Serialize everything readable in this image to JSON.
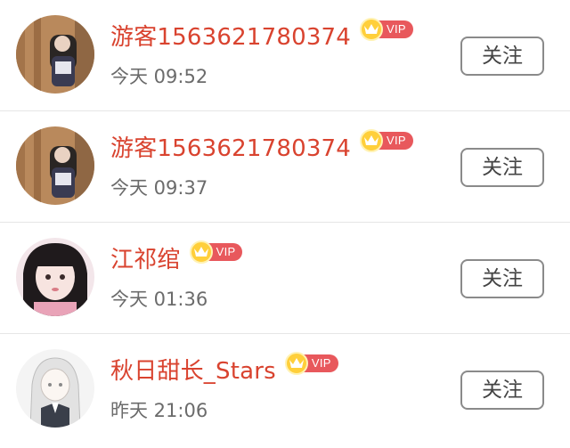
{
  "vip_label": "VIP",
  "users": [
    {
      "name": "游客1563621780374",
      "time": "今天 09:52",
      "follow_label": "关注",
      "avatar_icon": "photo-avatar-girl-wood"
    },
    {
      "name": "游客1563621780374",
      "time": "今天 09:37",
      "follow_label": "关注",
      "avatar_icon": "photo-avatar-girl-wood"
    },
    {
      "name": "江祁绾",
      "time": "今天 01:36",
      "follow_label": "关注",
      "avatar_icon": "photo-avatar-girl-portrait"
    },
    {
      "name": "秋日甜长_Stars",
      "time": "昨天 21:06",
      "follow_label": "关注",
      "avatar_icon": "anime-avatar-girl"
    }
  ],
  "colors": {
    "name": "#d9432f",
    "time": "#6b6b6b",
    "vip_badge": "#e8585c",
    "crown": "#ffcf3a"
  }
}
